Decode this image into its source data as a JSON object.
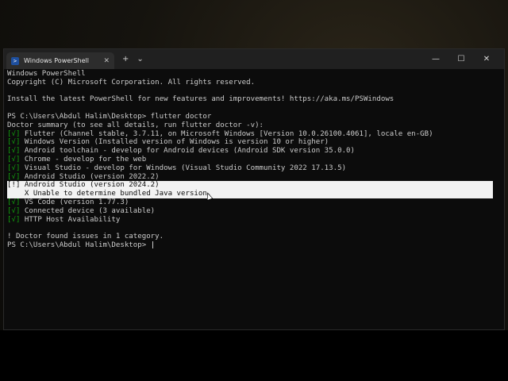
{
  "window": {
    "tab_title": "Windows PowerShell",
    "new_tab": "+",
    "dropdown": "⌄",
    "close_tab": "✕",
    "minimize": "—",
    "maximize": "☐",
    "close": "✕"
  },
  "terminal": {
    "lines": [
      {
        "mark": "",
        "text": "Windows PowerShell"
      },
      {
        "mark": "",
        "text": "Copyright (C) Microsoft Corporation. All rights reserved."
      },
      {
        "mark": "",
        "text": ""
      },
      {
        "mark": "",
        "text": "Install the latest PowerShell for new features and improvements! https://aka.ms/PSWindows"
      },
      {
        "mark": "",
        "text": ""
      },
      {
        "mark": "",
        "text": "PS C:\\Users\\Abdul Halim\\Desktop> flutter doctor"
      },
      {
        "mark": "",
        "text": "Doctor summary (to see all details, run flutter doctor -v):"
      },
      {
        "mark": "[√]",
        "text": " Flutter (Channel stable, 3.7.11, on Microsoft Windows [Version 10.0.26100.4061], locale en-GB)"
      },
      {
        "mark": "[√]",
        "text": " Windows Version (Installed version of Windows is version 10 or higher)"
      },
      {
        "mark": "[√]",
        "text": " Android toolchain - develop for Android devices (Android SDK version 35.0.0)"
      },
      {
        "mark": "[√]",
        "text": " Chrome - develop for the web"
      },
      {
        "mark": "[√]",
        "text": " Visual Studio - develop for Windows (Visual Studio Community 2022 17.13.5)"
      },
      {
        "mark": "[√]",
        "text": " Android Studio (version 2022.2)"
      },
      {
        "mark": "[!]",
        "text": " Android Studio (version 2024.2)",
        "highlight": true
      },
      {
        "mark": "",
        "text": "    X Unable to determine bundled Java version.",
        "highlight": true
      },
      {
        "mark": "[√]",
        "text": " VS Code (version 1.77.3)"
      },
      {
        "mark": "[√]",
        "text": " Connected device (3 available)"
      },
      {
        "mark": "[√]",
        "text": " HTTP Host Availability"
      },
      {
        "mark": "",
        "text": ""
      },
      {
        "mark": "",
        "text": "! Doctor found issues in 1 category."
      },
      {
        "mark": "",
        "text": "PS C:\\Users\\Abdul Halim\\Desktop> ",
        "cursor": true
      }
    ]
  }
}
